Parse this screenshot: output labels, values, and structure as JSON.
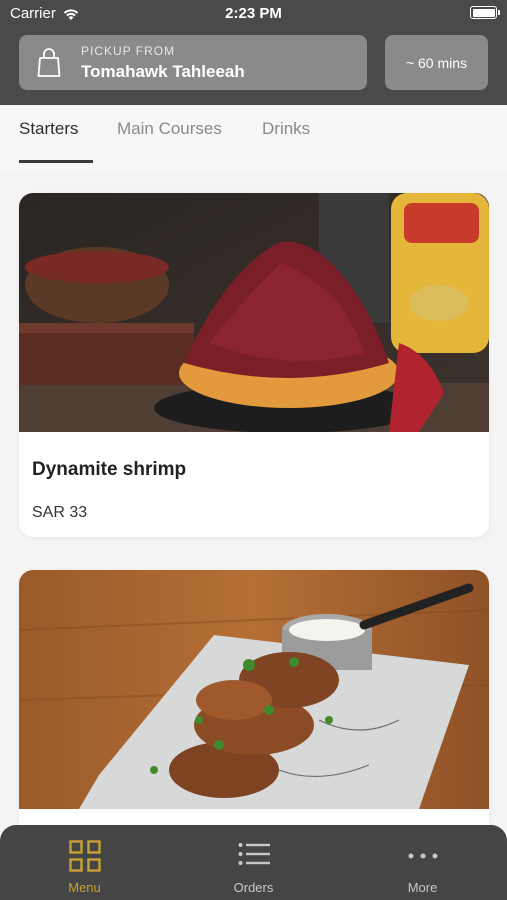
{
  "status_bar": {
    "carrier": "Carrier",
    "time": "2:23 PM"
  },
  "header": {
    "pickup_label": "PICKUP FROM",
    "pickup_location": "Tomahawk Tahleeah",
    "eta": "~ 60 mins"
  },
  "tabs": [
    {
      "label": "Starters",
      "active": true
    },
    {
      "label": "Main Courses",
      "active": false
    },
    {
      "label": "Drinks",
      "active": false
    }
  ],
  "items": [
    {
      "name": "Dynamite shrimp",
      "price": "SAR 33",
      "image_icon": "food-photo"
    },
    {
      "name": "",
      "price": "",
      "image_icon": "food-photo"
    }
  ],
  "bottom_nav": [
    {
      "label": "Menu",
      "icon": "grid-icon",
      "active": true
    },
    {
      "label": "Orders",
      "icon": "list-icon",
      "active": false
    },
    {
      "label": "More",
      "icon": "dots-icon",
      "active": false
    }
  ],
  "colors": {
    "header_bg": "#4a4a4a",
    "accent": "#c9a032",
    "nav_bg": "#454545"
  }
}
